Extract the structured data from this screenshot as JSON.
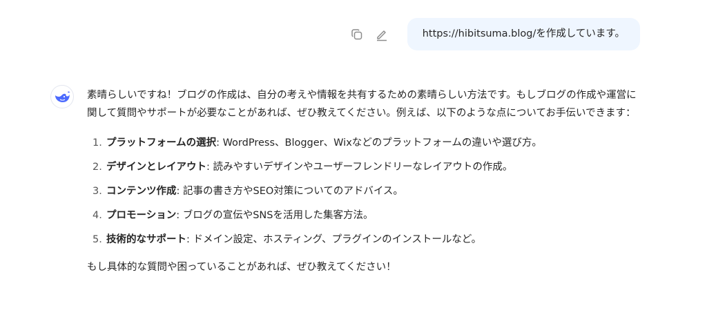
{
  "user_message": {
    "text": "https://hibitsuma.blog/を作成しています。",
    "actions": {
      "copy_icon": "copy-icon",
      "edit_icon": "edit-icon"
    }
  },
  "assistant_message": {
    "avatar_icon": "whale-logo-icon",
    "intro": "素晴らしいですね！ブログの作成は、自分の考えや情報を共有するための素晴らしい方法です。もしブログの作成や運営に関して質問やサポートが必要なことがあれば、ぜひ教えてください。例えば、以下のような点についてお手伝いできます：",
    "items": [
      {
        "num": "1.",
        "term": "プラットフォームの選択",
        "desc": ": WordPress、Blogger、Wixなどのプラットフォームの違いや選び方。"
      },
      {
        "num": "2.",
        "term": "デザインとレイアウト",
        "desc": ": 読みやすいデザインやユーザーフレンドリーなレイアウトの作成。"
      },
      {
        "num": "3.",
        "term": "コンテンツ作成",
        "desc": ": 記事の書き方やSEO対策についてのアドバイス。"
      },
      {
        "num": "4.",
        "term": "プロモーション",
        "desc": ": ブログの宣伝やSNSを活用した集客方法。"
      },
      {
        "num": "5.",
        "term": "技術的なサポート",
        "desc": ": ドメイン設定、ホスティング、プラグインのインストールなど。"
      }
    ],
    "closing": "もし具体的な質問や困っていることがあれば、ぜひ教えてください！"
  },
  "colors": {
    "user_bubble_bg": "#eff6ff",
    "accent": "#4d6bfe",
    "text": "#262626"
  }
}
